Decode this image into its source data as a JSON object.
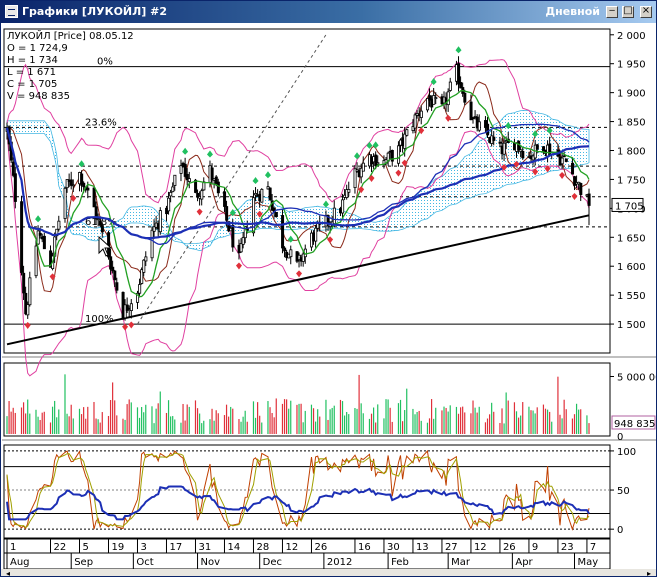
{
  "window": {
    "title": "Графики [ЛУКОЙЛ] #2",
    "period": "Дневной",
    "buttons": {
      "minimize": "‒",
      "maximize": "□",
      "close": "×"
    }
  },
  "colors": {
    "price": "#000000",
    "ma_blue": "#1c2fb5",
    "ma_green": "#22a022",
    "bollinger": "#e040a0",
    "brown": "#8b2a1a",
    "ichimoku": "#30b0e0",
    "ichimoku_green": "#40c040",
    "up": "#20c060",
    "down": "#e0303a",
    "stoch_k": "#c04000",
    "stoch_d": "#a0a000",
    "rsi": "#1c2fb5",
    "trend": "#000000"
  },
  "chart_data": [
    {
      "type": "candlestick",
      "title": "ЛУКОЙЛ [Price] 08.05.12",
      "ohlcv_label": [
        "O = 1 724,9",
        "H = 1 734",
        "L = 1 671",
        "C = 1 705",
        "V = 948 835"
      ],
      "y_ticks": [
        2000,
        1950,
        1900,
        1850,
        1800,
        1750,
        1700,
        1650,
        1600,
        1550,
        1500
      ],
      "y_tick_labels": [
        "2 000",
        "1 950",
        "1 900",
        "1 850",
        "1 800",
        "1 750",
        "1 700",
        "1 650",
        "1 600",
        "1 550",
        "1 500"
      ],
      "ylim": [
        1450,
        2010
      ],
      "last_price_label": "1 705",
      "fib_levels": [
        {
          "label": "0%",
          "value": 1945
        },
        {
          "label": "23.6%",
          "value": 1840
        },
        {
          "label": "",
          "value": 1773
        },
        {
          "label": "",
          "value": 1720
        },
        {
          "label": "61.8%",
          "value": 1668
        },
        {
          "label": "100%",
          "value": 1500
        }
      ],
      "trend_line": [
        {
          "x": "2011-08-01",
          "y": 1465
        },
        {
          "x": "2012-05-08",
          "y": 1688
        }
      ],
      "close_anchors": [
        [
          "2011-08-01",
          1835
        ],
        [
          "2011-08-05",
          1720
        ],
        [
          "2011-08-10",
          1520
        ],
        [
          "2011-08-16",
          1660
        ],
        [
          "2011-08-22",
          1605
        ],
        [
          "2011-08-29",
          1735
        ],
        [
          "2011-09-05",
          1760
        ],
        [
          "2011-09-12",
          1700
        ],
        [
          "2011-09-19",
          1620
        ],
        [
          "2011-09-26",
          1520
        ],
        [
          "2011-10-03",
          1560
        ],
        [
          "2011-10-10",
          1660
        ],
        [
          "2011-10-17",
          1700
        ],
        [
          "2011-10-24",
          1780
        ],
        [
          "2011-10-31",
          1720
        ],
        [
          "2011-11-07",
          1765
        ],
        [
          "2011-11-14",
          1690
        ],
        [
          "2011-11-21",
          1610
        ],
        [
          "2011-11-28",
          1720
        ],
        [
          "2011-12-05",
          1735
        ],
        [
          "2011-12-12",
          1640
        ],
        [
          "2011-12-19",
          1600
        ],
        [
          "2011-12-26",
          1650
        ],
        [
          "2012-01-09",
          1700
        ],
        [
          "2012-01-16",
          1760
        ],
        [
          "2012-01-23",
          1790
        ],
        [
          "2012-01-30",
          1780
        ],
        [
          "2012-02-06",
          1800
        ],
        [
          "2012-02-13",
          1850
        ],
        [
          "2012-02-20",
          1890
        ],
        [
          "2012-02-27",
          1870
        ],
        [
          "2012-03-05",
          1935
        ],
        [
          "2012-03-09",
          1895
        ],
        [
          "2012-03-13",
          1850
        ],
        [
          "2012-03-19",
          1830
        ],
        [
          "2012-03-26",
          1800
        ],
        [
          "2012-04-02",
          1815
        ],
        [
          "2012-04-09",
          1790
        ],
        [
          "2012-04-16",
          1810
        ],
        [
          "2012-04-23",
          1790
        ],
        [
          "2012-04-27",
          1780
        ],
        [
          "2012-05-03",
          1740
        ],
        [
          "2012-05-08",
          1705
        ]
      ]
    },
    {
      "type": "bar",
      "title": "Volume",
      "y_tick_labels": [
        "5 000 000",
        "0"
      ],
      "ylim": [
        0,
        6000000
      ],
      "last_value_label": "948 835"
    },
    {
      "type": "line",
      "title": "Oscillators",
      "ylim": [
        -10,
        105
      ],
      "y_ticks": [
        100,
        50,
        0
      ],
      "y_tick_labels": [
        "100",
        "50",
        "0"
      ],
      "levels": [
        80,
        50,
        20
      ]
    }
  ],
  "x_axis": {
    "start": "2011-08-01",
    "end": "2012-05-08",
    "day_ticks": [
      {
        "label": "1",
        "date": "2011-08-01"
      },
      {
        "label": "22",
        "date": "2011-08-22"
      },
      {
        "label": "5",
        "date": "2011-09-05"
      },
      {
        "label": "19",
        "date": "2011-09-19"
      },
      {
        "label": "3",
        "date": "2011-10-03"
      },
      {
        "label": "17",
        "date": "2011-10-17"
      },
      {
        "label": "31",
        "date": "2011-10-31"
      },
      {
        "label": "14",
        "date": "2011-11-14"
      },
      {
        "label": "28",
        "date": "2011-11-28"
      },
      {
        "label": "12",
        "date": "2011-12-12"
      },
      {
        "label": "26",
        "date": "2011-12-26"
      },
      {
        "label": "16",
        "date": "2012-01-16"
      },
      {
        "label": "30",
        "date": "2012-01-30"
      },
      {
        "label": "13",
        "date": "2012-02-13"
      },
      {
        "label": "27",
        "date": "2012-02-27"
      },
      {
        "label": "12",
        "date": "2012-03-12"
      },
      {
        "label": "26",
        "date": "2012-03-26"
      },
      {
        "label": "9",
        "date": "2012-04-09"
      },
      {
        "label": "23",
        "date": "2012-04-23"
      },
      {
        "label": "7",
        "date": "2012-05-07"
      }
    ],
    "month_ticks": [
      {
        "label": "Aug",
        "date": "2011-08-01"
      },
      {
        "label": "Sep",
        "date": "2011-09-01"
      },
      {
        "label": "Oct",
        "date": "2011-10-01"
      },
      {
        "label": "Nov",
        "date": "2011-11-01"
      },
      {
        "label": "Dec",
        "date": "2011-12-01"
      },
      {
        "label": "2012",
        "date": "2012-01-01"
      },
      {
        "label": "Feb",
        "date": "2012-02-01"
      },
      {
        "label": "Mar",
        "date": "2012-03-01"
      },
      {
        "label": "Apr",
        "date": "2012-04-01"
      },
      {
        "label": "May",
        "date": "2012-05-01"
      }
    ]
  }
}
